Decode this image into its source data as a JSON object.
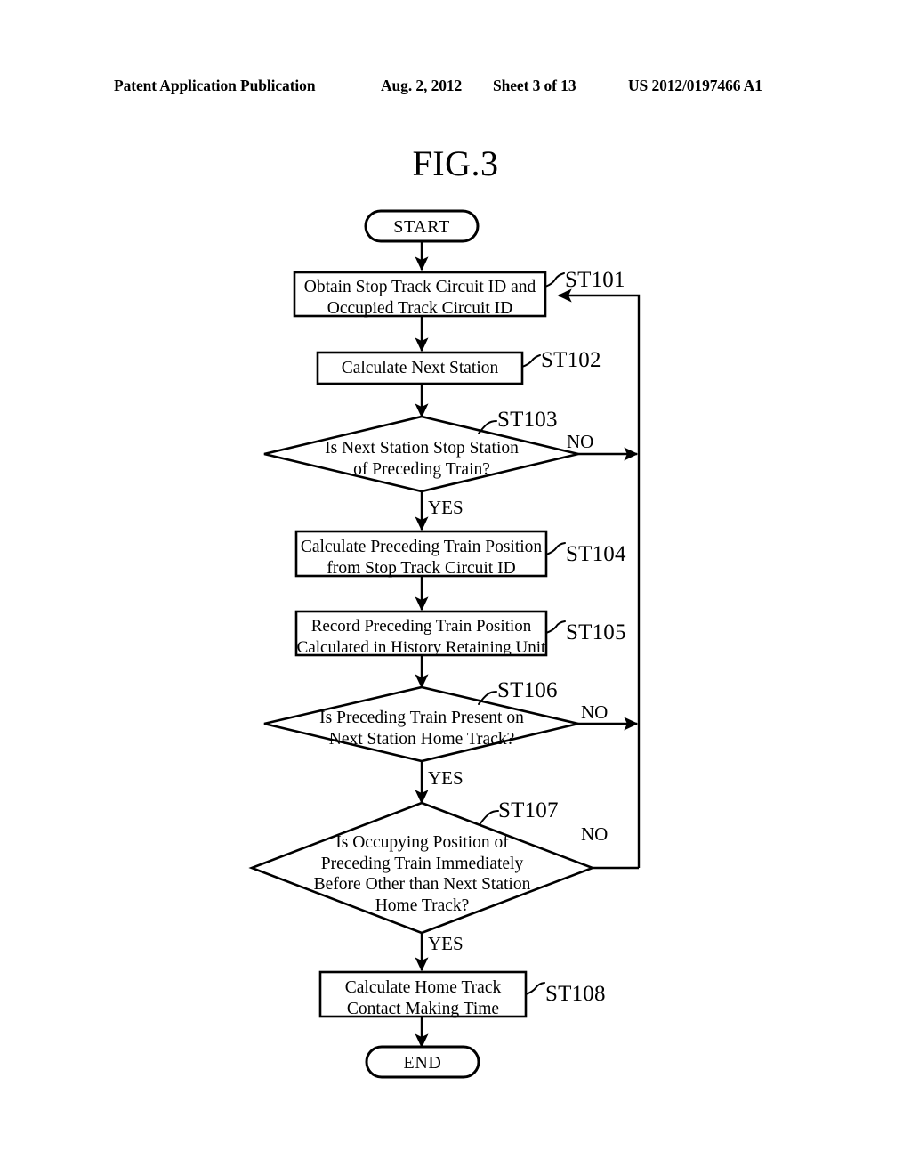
{
  "header": {
    "publication": "Patent Application Publication",
    "date": "Aug. 2, 2012",
    "sheet": "Sheet 3 of 13",
    "patent_number": "US 2012/0197466 A1"
  },
  "figure": {
    "title": "FIG.3"
  },
  "flowchart": {
    "start_label": "START",
    "end_label": "END",
    "yes_label": "YES",
    "no_label": "NO",
    "steps": [
      {
        "id": "ST101",
        "type": "process",
        "lines": [
          "Obtain Stop Track Circuit ID and",
          "Occupied Track Circuit ID"
        ]
      },
      {
        "id": "ST102",
        "type": "process",
        "lines": [
          "Calculate Next Station"
        ]
      },
      {
        "id": "ST103",
        "type": "decision",
        "lines": [
          "Is Next Station Stop Station",
          "of Preceding Train?"
        ]
      },
      {
        "id": "ST104",
        "type": "process",
        "lines": [
          "Calculate Preceding Train Position",
          "from Stop Track Circuit ID"
        ]
      },
      {
        "id": "ST105",
        "type": "process",
        "lines": [
          "Record Preceding Train Position",
          "Calculated in History Retaining Unit"
        ]
      },
      {
        "id": "ST106",
        "type": "decision",
        "lines": [
          "Is Preceding Train Present on",
          "Next Station Home Track?"
        ]
      },
      {
        "id": "ST107",
        "type": "decision",
        "lines": [
          "Is Occupying Position of",
          "Preceding Train Immediately",
          "Before Other than Next Station",
          "Home Track?"
        ]
      },
      {
        "id": "ST108",
        "type": "process",
        "lines": [
          "Calculate Home Track",
          "Contact Making Time"
        ]
      }
    ],
    "branches": [
      {
        "from": "ST103",
        "label": "NO",
        "direction": "right"
      },
      {
        "from": "ST103",
        "label": "YES",
        "direction": "down"
      },
      {
        "from": "ST106",
        "label": "NO",
        "direction": "right"
      },
      {
        "from": "ST106",
        "label": "YES",
        "direction": "down"
      },
      {
        "from": "ST107",
        "label": "NO",
        "direction": "right"
      },
      {
        "from": "ST107",
        "label": "YES",
        "direction": "down"
      }
    ],
    "feedback": {
      "description": "Loop back to ST101",
      "target": "ST101"
    }
  },
  "colors": {
    "ink": "#000000",
    "paper": "#ffffff"
  }
}
